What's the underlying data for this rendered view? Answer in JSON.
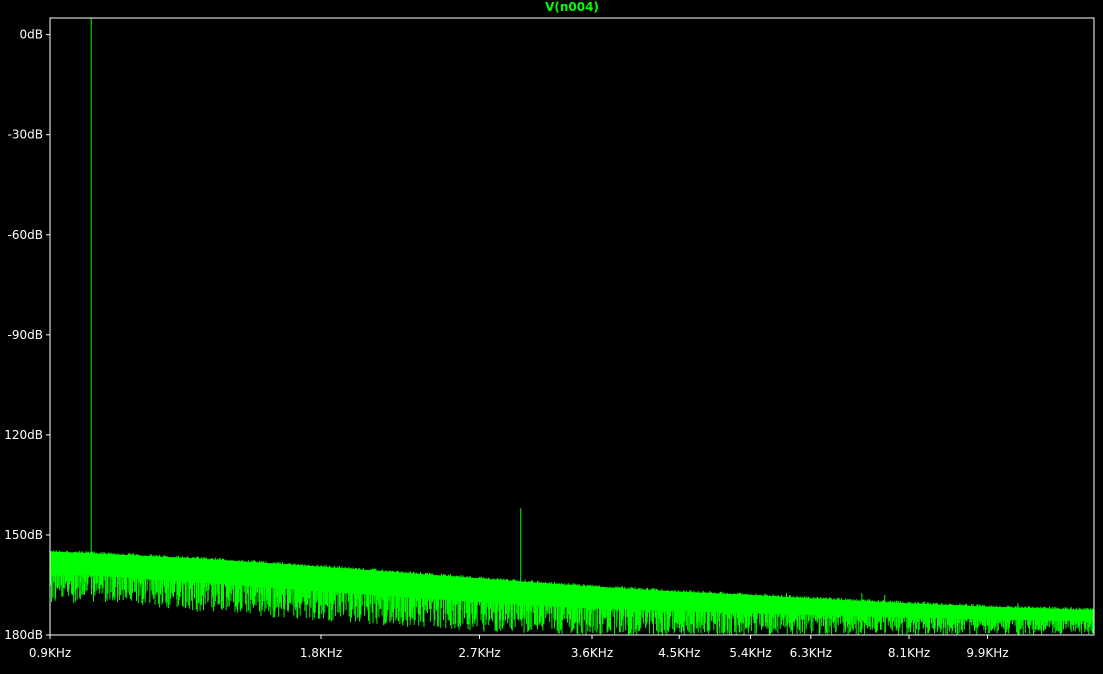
{
  "chart_data": {
    "type": "line",
    "title": "V(n004)",
    "x_scale": "log",
    "x_unit": "Hz",
    "xlim": [
      900,
      13000
    ],
    "ylim": [
      -180,
      5
    ],
    "x_ticks": [
      {
        "value": 900,
        "label": "0.9KHz"
      },
      {
        "value": 1800,
        "label": "1.8KHz"
      },
      {
        "value": 2700,
        "label": "2.7KHz"
      },
      {
        "value": 3600,
        "label": "3.6KHz"
      },
      {
        "value": 4500,
        "label": "4.5KHz"
      },
      {
        "value": 5400,
        "label": "5.4KHz"
      },
      {
        "value": 6300,
        "label": "6.3KHz"
      },
      {
        "value": 8100,
        "label": "8.1KHz"
      },
      {
        "value": 9900,
        "label": "9.9KHz"
      }
    ],
    "y_ticks": [
      {
        "value": 0,
        "label": "0dB"
      },
      {
        "value": -30,
        "label": "-30dB"
      },
      {
        "value": -60,
        "label": "-60dB"
      },
      {
        "value": -90,
        "label": "-90dB"
      },
      {
        "value": -120,
        "label": "120dB"
      },
      {
        "value": -150,
        "label": "150dB"
      },
      {
        "value": -180,
        "label": "180dB"
      }
    ],
    "grid": false,
    "series": [
      {
        "name": "V(n004)",
        "color": "#00ff00",
        "peaks": [
          {
            "x": 1000,
            "y": 5
          },
          {
            "x": 3000,
            "y": -142
          }
        ],
        "noise_floor_upper": [
          {
            "x": 900,
            "y": -155
          },
          {
            "x": 1000,
            "y": -155.5
          },
          {
            "x": 1300,
            "y": -157
          },
          {
            "x": 1800,
            "y": -159.5
          },
          {
            "x": 2700,
            "y": -163
          },
          {
            "x": 3600,
            "y": -165.5
          },
          {
            "x": 4500,
            "y": -167
          },
          {
            "x": 5400,
            "y": -168
          },
          {
            "x": 6300,
            "y": -169
          },
          {
            "x": 8100,
            "y": -170.5
          },
          {
            "x": 9900,
            "y": -171.5
          },
          {
            "x": 13000,
            "y": -172.5
          }
        ],
        "noise_floor_lower": [
          {
            "x": 900,
            "y": -171
          },
          {
            "x": 1000,
            "y": -170
          },
          {
            "x": 1300,
            "y": -173
          },
          {
            "x": 1800,
            "y": -176
          },
          {
            "x": 2700,
            "y": -179
          },
          {
            "x": 3600,
            "y": -180
          },
          {
            "x": 13000,
            "y": -180
          }
        ],
        "spurs": [
          {
            "x": 2030,
            "y": -160.5
          },
          {
            "x": 3740,
            "y": -165.5
          },
          {
            "x": 5920,
            "y": -167.5
          },
          {
            "x": 7180,
            "y": -167.5
          },
          {
            "x": 7610,
            "y": -168
          },
          {
            "x": 8430,
            "y": -170
          },
          {
            "x": 10700,
            "y": -170.5
          }
        ]
      }
    ]
  },
  "colors": {
    "background": "#000000",
    "trace": "#00ff00",
    "axis": "#ffffff",
    "tick_label": "#ffffff",
    "title": "#00ff00"
  }
}
